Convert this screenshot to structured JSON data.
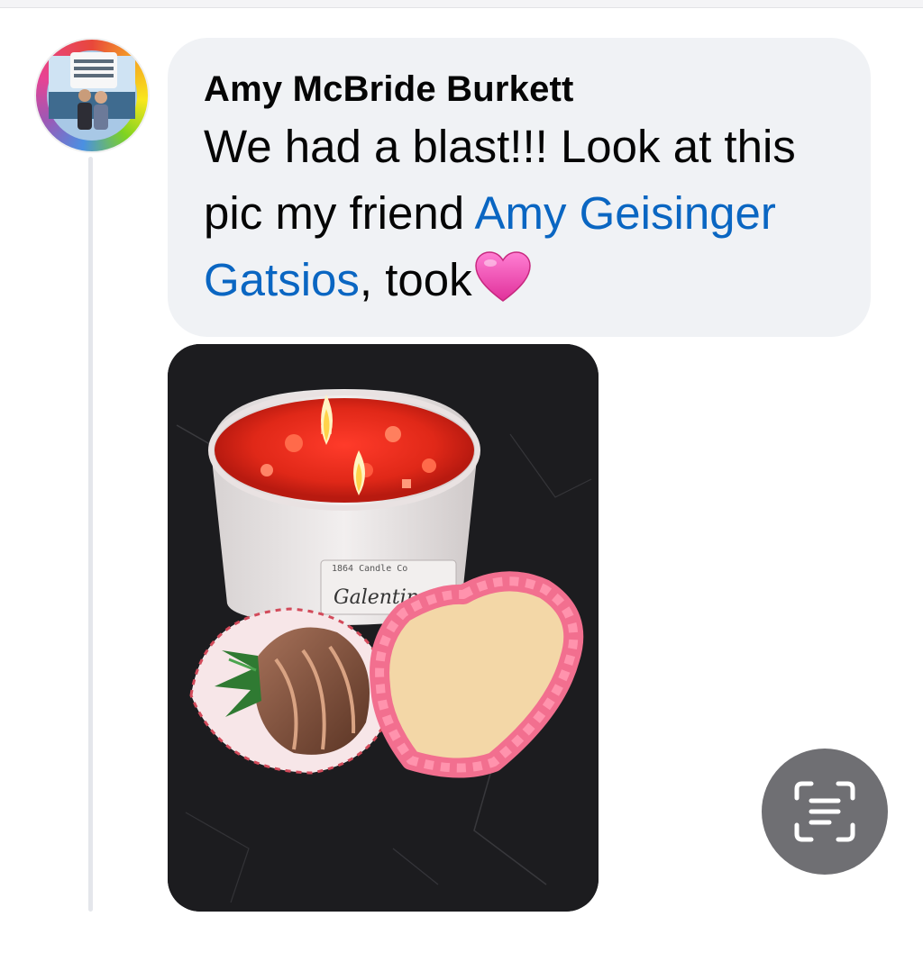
{
  "comment": {
    "author": "Amy McBride Burkett",
    "text_before_mention": "We had a blast!!! Look at this pic my friend ",
    "mention": "Amy Geisinger Gatsios",
    "text_after_mention": ", took",
    "emoji": "pink-heart",
    "photo_label": "1864 Candle Co",
    "photo_label_script": "Galentine's"
  },
  "icons": {
    "avatar": "user-avatar",
    "scan_button": "live-text-scan-icon"
  },
  "colors": {
    "bubble_bg": "#f0f2f5",
    "mention": "#0a66c2",
    "thread_line": "#e4e6eb",
    "scan_button_bg": "#6f6f73"
  }
}
